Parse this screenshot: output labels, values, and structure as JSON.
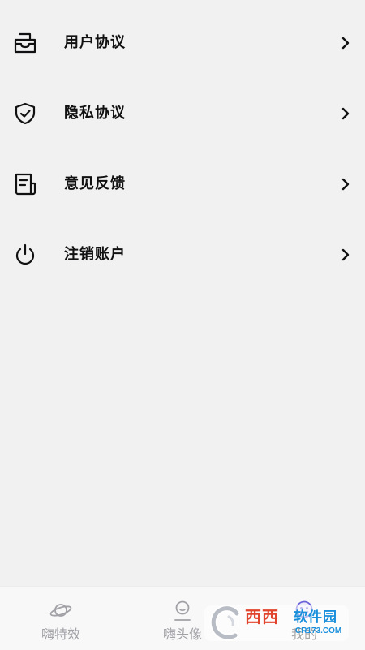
{
  "menu": {
    "items": [
      {
        "label": "用户协议",
        "icon": "envelope-tray-icon"
      },
      {
        "label": "隐私协议",
        "icon": "shield-check-icon"
      },
      {
        "label": "意见反馈",
        "icon": "document-note-icon"
      },
      {
        "label": "注销账户",
        "icon": "power-icon"
      }
    ]
  },
  "tabbar": {
    "tabs": [
      {
        "label": "嗨特效",
        "icon": "planet-icon",
        "active": false
      },
      {
        "label": "嗨头像",
        "icon": "avatar-face-icon",
        "active": false
      },
      {
        "label": "我的",
        "icon": "smiley-bubble-icon",
        "active": true
      }
    ]
  },
  "watermark": {
    "title": "西西",
    "subtitle": "软件园",
    "url": "CR173.COM"
  },
  "colors": {
    "background": "#f1f1f2",
    "text": "#111111",
    "tab_inactive": "#a1a1a6",
    "tab_active_icon": "#6b63d9"
  }
}
